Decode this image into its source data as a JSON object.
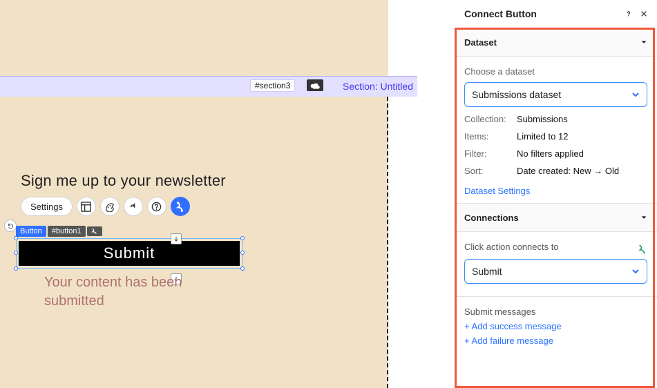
{
  "canvas": {
    "section_id": "#section3",
    "section_label": "Section: Untitled",
    "newsletter_title": "Sign me up to your newsletter",
    "toolbar": {
      "settings_label": "Settings"
    },
    "selection": {
      "type_label": "Button",
      "id_label": "#button1",
      "button_text": "Submit"
    },
    "submitted_text": "Your content has been submitted"
  },
  "panel": {
    "title": "Connect Button",
    "dataset_section": {
      "heading": "Dataset",
      "choose_label": "Choose a dataset",
      "selected_dataset": "Submissions dataset",
      "collection_label": "Collection:",
      "collection_value": "Submissions",
      "items_label": "Items:",
      "items_value": "Limited to 12",
      "filter_label": "Filter:",
      "filter_value": "No filters applied",
      "sort_label": "Sort:",
      "sort_value": "Date created: New → Old",
      "settings_link": "Dataset Settings"
    },
    "connections_section": {
      "heading": "Connections",
      "click_action_label": "Click action connects to",
      "selected_action": "Submit",
      "submit_msgs_label": "Submit messages",
      "add_success": "+ Add success message",
      "add_failure": "+ Add failure message"
    }
  }
}
